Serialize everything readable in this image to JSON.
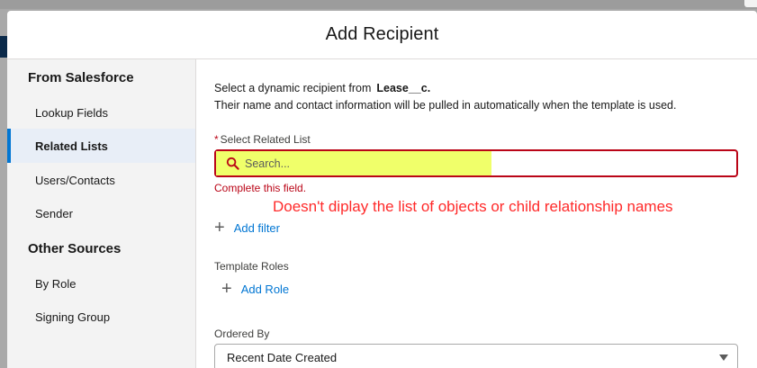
{
  "modal": {
    "title": "Add Recipient"
  },
  "sidebar": {
    "from_salesforce_title": "From Salesforce",
    "items_salesforce": [
      {
        "label": "Lookup Fields",
        "active": false
      },
      {
        "label": "Related Lists",
        "active": true
      },
      {
        "label": "Users/Contacts",
        "active": false
      },
      {
        "label": "Sender",
        "active": false
      }
    ],
    "other_sources_title": "Other Sources",
    "items_other": [
      {
        "label": "By Role"
      },
      {
        "label": "Signing Group"
      }
    ]
  },
  "content": {
    "intro_line1": "Select a dynamic recipient from",
    "object_name": "Lease__c.",
    "intro_line2": "Their name and contact information will be pulled in automatically when the template is used.",
    "related_list_label": "Select Related List",
    "required_mark": "*",
    "search_placeholder": "Search...",
    "search_value": "",
    "error_text": "Complete this field.",
    "annotation": "Doesn't diplay the list of objects or child relationship names",
    "add_filter_label": "Add filter",
    "template_roles_label": "Template Roles",
    "add_role_label": "Add Role",
    "ordered_by_label": "Ordered By",
    "ordered_by_value": "Recent Date Created"
  },
  "colors": {
    "error": "#ba0517",
    "link": "#0176d3",
    "highlight": "#f0ff6a",
    "annotation": "#ff2a2a",
    "active_nav": "#0176d3"
  }
}
